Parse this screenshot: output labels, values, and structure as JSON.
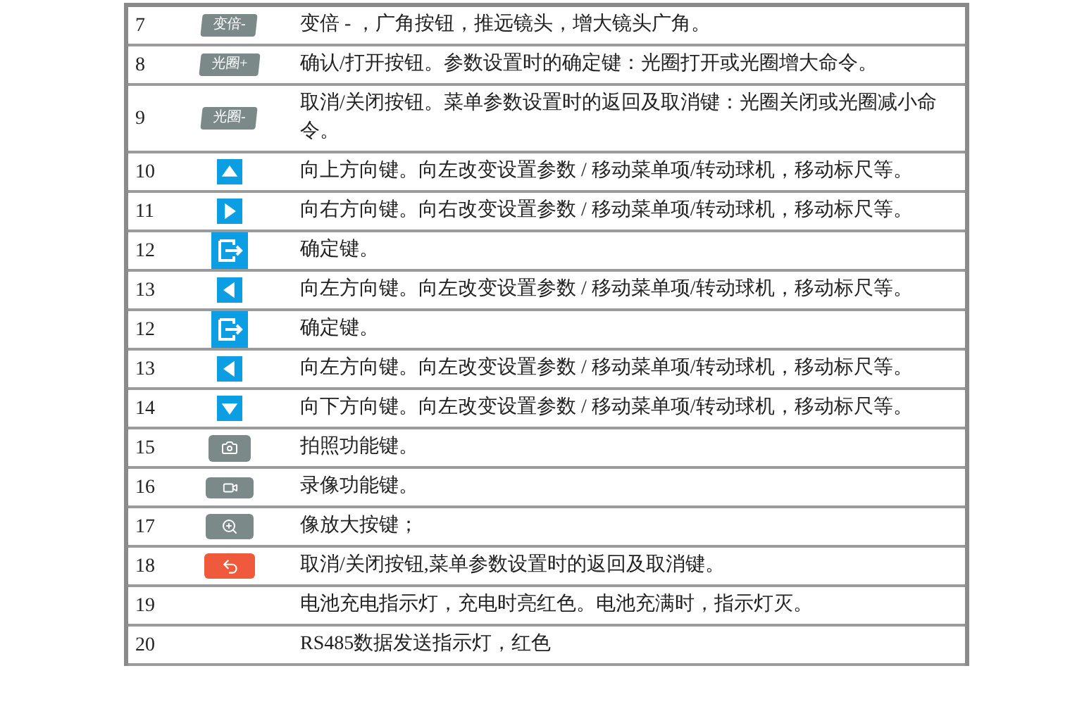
{
  "rows": [
    {
      "number": "7",
      "icon": {
        "kind": "label",
        "label": "变倍-"
      },
      "description": "变倍 - ，广角按钮，推远镜头，增大镜头广角。"
    },
    {
      "number": "8",
      "icon": {
        "kind": "label",
        "label": "光圈+"
      },
      "description": "确认/打开按钮。参数设置时的确定键：光圈打开或光圈增大命令。"
    },
    {
      "number": "9",
      "icon": {
        "kind": "label",
        "label": "光圈-"
      },
      "description": "取消/关闭按钮。菜单参数设置时的返回及取消键：光圈关闭或光圈减小命令。"
    },
    {
      "number": "10",
      "icon": {
        "kind": "up"
      },
      "description": "向上方向键。向左改变设置参数 / 移动菜单项/转动球机，移动标尺等。"
    },
    {
      "number": "11",
      "icon": {
        "kind": "right"
      },
      "description": "向右方向键。向右改变设置参数 / 移动菜单项/转动球机，移动标尺等。"
    },
    {
      "number": "12",
      "icon": {
        "kind": "enter"
      },
      "description": "确定键。"
    },
    {
      "number": "13",
      "icon": {
        "kind": "left"
      },
      "description": "向左方向键。向左改变设置参数 / 移动菜单项/转动球机，移动标尺等。"
    },
    {
      "number": "12",
      "icon": {
        "kind": "enter"
      },
      "description": "确定键。"
    },
    {
      "number": "13",
      "icon": {
        "kind": "left"
      },
      "description": "向左方向键。向左改变设置参数 / 移动菜单项/转动球机，移动标尺等。"
    },
    {
      "number": "14",
      "icon": {
        "kind": "down"
      },
      "description": "向下方向键。向左改变设置参数 / 移动菜单项/转动球机，移动标尺等。"
    },
    {
      "number": "15",
      "icon": {
        "kind": "camera"
      },
      "description": "拍照功能键。"
    },
    {
      "number": "16",
      "icon": {
        "kind": "video"
      },
      "description": "录像功能键。"
    },
    {
      "number": "17",
      "icon": {
        "kind": "zoom"
      },
      "description": "像放大按键；"
    },
    {
      "number": "18",
      "icon": {
        "kind": "back"
      },
      "description": "取消/关闭按钮,菜单参数设置时的返回及取消键。"
    },
    {
      "number": "19",
      "description": "电池充电指示灯，充电时亮红色。电池充满时，指示灯灭。"
    },
    {
      "number": "20",
      "description": "RS485数据发送指示灯，红色"
    }
  ]
}
